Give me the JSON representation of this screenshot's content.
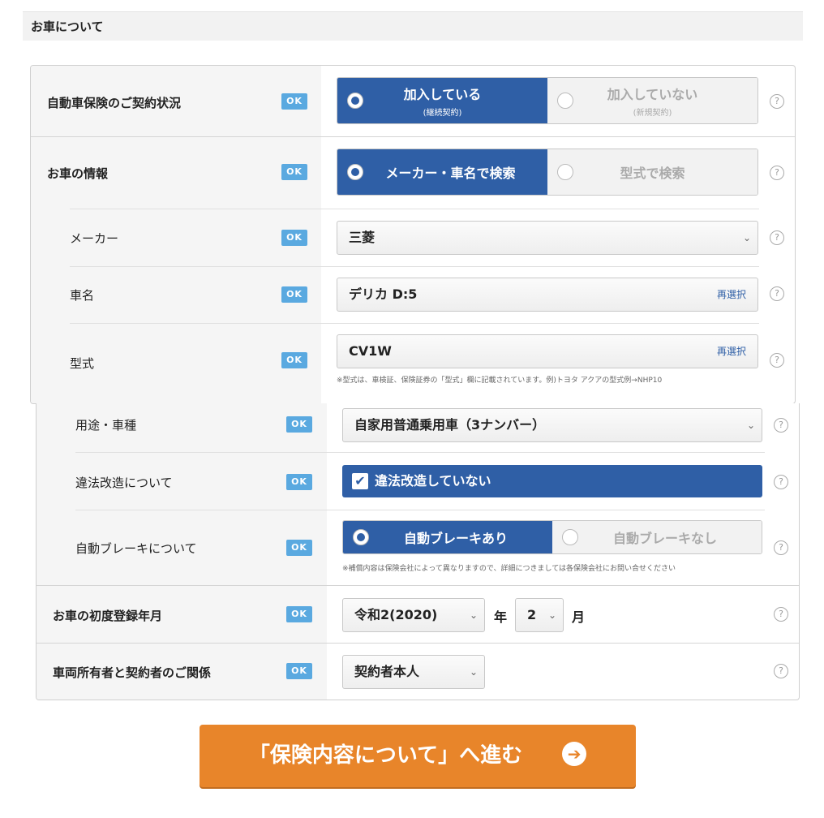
{
  "section": {
    "title": "お車について"
  },
  "ok_label": "OK",
  "help_label": "?",
  "contract": {
    "label": "自動車保険のご契約状況",
    "options": [
      {
        "label": "加入している",
        "sub": "(継続契約)",
        "selected": true
      },
      {
        "label": "加入していない",
        "sub": "(新規契約)",
        "selected": false
      }
    ]
  },
  "car_info": {
    "label": "お車の情報",
    "options": [
      {
        "label": "メーカー・車名で検索",
        "selected": true
      },
      {
        "label": "型式で検索",
        "selected": false
      }
    ]
  },
  "maker": {
    "label": "メーカー",
    "value": "三菱",
    "chevron": "⌄"
  },
  "car_name": {
    "label": "車名",
    "value": "デリカ D:5",
    "reselect": "再選択"
  },
  "model": {
    "label": "型式",
    "value": "CV1W",
    "reselect": "再選択",
    "note": "※型式は、車検証、保険証券の「型式」欄に記載されています。例)トヨタ アクアの型式例→NHP10"
  },
  "usage": {
    "label": "用途・車種",
    "value": "自家用普通乗用車（3ナンバー）",
    "chevron": "⌄"
  },
  "modification": {
    "label": "違法改造について",
    "value": "違法改造していない",
    "checked": true,
    "check_mark": "✔"
  },
  "auto_brake": {
    "label": "自動ブレーキについて",
    "options": [
      {
        "label": "自動ブレーキあり",
        "selected": true
      },
      {
        "label": "自動ブレーキなし",
        "selected": false
      }
    ],
    "note": "※補償内容は保険会社によって異なりますので、詳細につきましては各保険会社にお問い合せください"
  },
  "first_registration": {
    "label": "お車の初度登録年月",
    "year": "令和2(2020)",
    "year_unit": "年",
    "month": "2",
    "month_unit": "月",
    "chevron": "⌄"
  },
  "owner_relation": {
    "label": "車両所有者と契約者のご関係",
    "value": "契約者本人",
    "chevron": "⌄"
  },
  "cta": {
    "label": "「保険内容について」へ進む",
    "icon": "➔"
  },
  "colors": {
    "accent_blue": "#2f5fa6",
    "ok_blue": "#5aa9e0",
    "cta_orange": "#e8852a"
  }
}
